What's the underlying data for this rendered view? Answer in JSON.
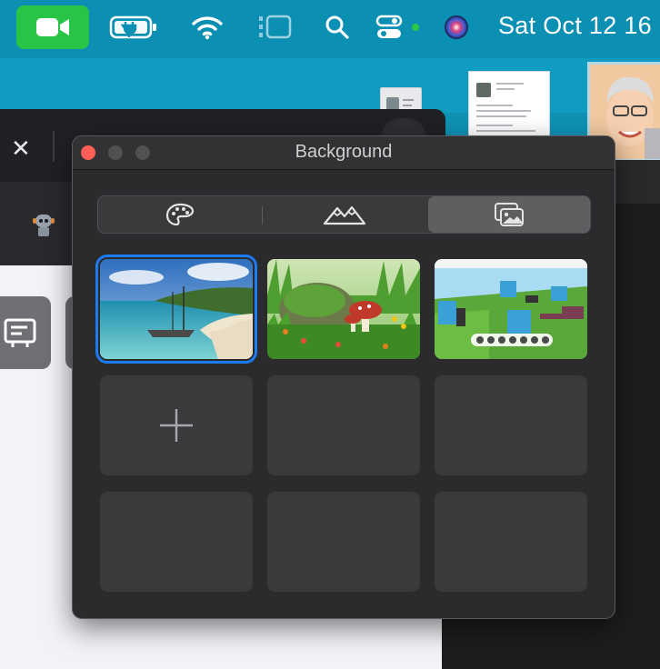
{
  "menubar": {
    "clock": "Sat Oct 12  16",
    "icons": [
      "facetime-video-icon",
      "battery-charging-icon",
      "wifi-icon",
      "stage-manager-icon",
      "search-icon",
      "control-center-icon",
      "siri-icon"
    ],
    "colors": {
      "facetime_green": "#27c445",
      "background": "#0b8fb3"
    }
  },
  "browser": {
    "close_label": "✕"
  },
  "panel": {
    "title": "Background",
    "tabs": [
      {
        "icon": "palette-icon",
        "selected": false
      },
      {
        "icon": "mountains-icon",
        "selected": false
      },
      {
        "icon": "photos-icon",
        "selected": true
      }
    ],
    "thumbnails": [
      {
        "name": "beach-with-boat",
        "selected": true
      },
      {
        "name": "mushroom-meadow",
        "selected": false
      },
      {
        "name": "virtual-office-3d",
        "selected": false
      }
    ],
    "add_button_icon": "plus-icon",
    "colors": {
      "selection": "#1a7bf2",
      "panel_bg": "#2b2b2d",
      "cell_bg": "#3a3a3c"
    }
  }
}
